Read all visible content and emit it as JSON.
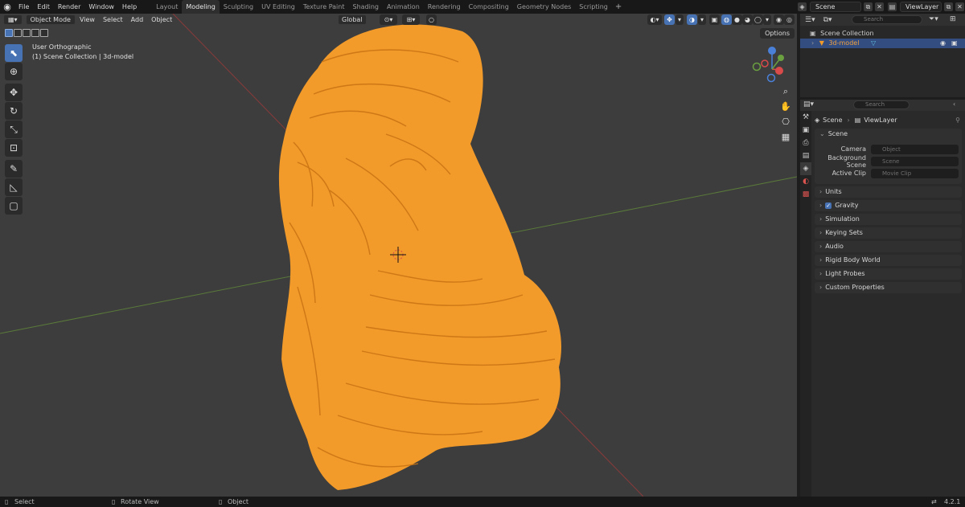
{
  "top_menu": [
    "File",
    "Edit",
    "Render",
    "Window",
    "Help"
  ],
  "workspaces": [
    "Layout",
    "Modeling",
    "Sculpting",
    "UV Editing",
    "Texture Paint",
    "Shading",
    "Animation",
    "Rendering",
    "Compositing",
    "Geometry Nodes",
    "Scripting"
  ],
  "active_workspace": "Modeling",
  "scene_name": "Scene",
  "view_layer_name": "ViewLayer",
  "viewport": {
    "mode": "Object Mode",
    "menus": [
      "View",
      "Select",
      "Add",
      "Object"
    ],
    "transform_orientation": "Global",
    "view_name": "User Orthographic",
    "collection_info": "(1) Scene Collection | 3d-model",
    "options_label": "Options",
    "model_color": "#f29a2a",
    "grid_x_color": "#8a3a3a",
    "grid_y_color": "#5a7a3a"
  },
  "outliner": {
    "search_placeholder": "Search",
    "root": "Scene Collection",
    "selected_item": "3d-model"
  },
  "properties": {
    "search_placeholder": "Search",
    "breadcrumb_scene": "Scene",
    "breadcrumb_layer": "ViewLayer",
    "panel_title": "Scene",
    "camera_label": "Camera",
    "camera_placeholder": "Object",
    "bg_scene_label": "Background Scene",
    "bg_scene_placeholder": "Scene",
    "active_clip_label": "Active Clip",
    "active_clip_placeholder": "Movie Clip",
    "panels": [
      "Units",
      "Gravity",
      "Simulation",
      "Keying Sets",
      "Audio",
      "Rigid Body World",
      "Light Probes",
      "Custom Properties"
    ],
    "gravity_checked": true
  },
  "statusbar": {
    "select": "Select",
    "rotate": "Rotate View",
    "object": "Object",
    "version": "4.2.1"
  }
}
